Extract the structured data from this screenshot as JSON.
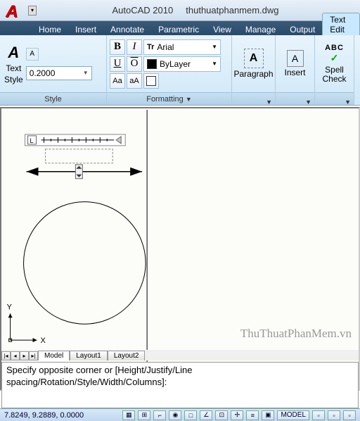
{
  "title": {
    "app": "AutoCAD 2010",
    "file": "thuthuatphanmem.dwg"
  },
  "tabs": {
    "home": "Home",
    "insert": "Insert",
    "annotate": "Annotate",
    "parametric": "Parametric",
    "view": "View",
    "manage": "Manage",
    "output": "Output",
    "textedit": "Text Edit"
  },
  "style_panel": {
    "label": "Style",
    "text": "Text",
    "style": "Style",
    "size": "0.2000",
    "icon": "A"
  },
  "fmt_panel": {
    "label": "Formatting",
    "font": "Arial",
    "layer": "ByLayer",
    "bold": "B",
    "italic": "I",
    "under": "U",
    "over": "O",
    "aa1": "Aa",
    "aa2": "aA",
    "tt": "Tr"
  },
  "para_panel": {
    "label": "Paragraph",
    "icon": "A"
  },
  "insert_panel": {
    "label": "Insert",
    "icon": "A"
  },
  "spell_panel": {
    "label1": "Spell",
    "label2": "Check",
    "abc": "ABC",
    "chk": "✓"
  },
  "layout": {
    "model": "Model",
    "l1": "Layout1",
    "l2": "Layout2"
  },
  "cmdline": "Specify opposite corner or [Height/Justify/Line spacing/Rotation/Style/Width/Columns]:",
  "status": {
    "coords": "7.8249, 9.2889, 0.0000",
    "model": "MODEL"
  },
  "watermark": "ThuThuatPhanMem.vn",
  "axes": {
    "x": "X",
    "y": "Y"
  }
}
